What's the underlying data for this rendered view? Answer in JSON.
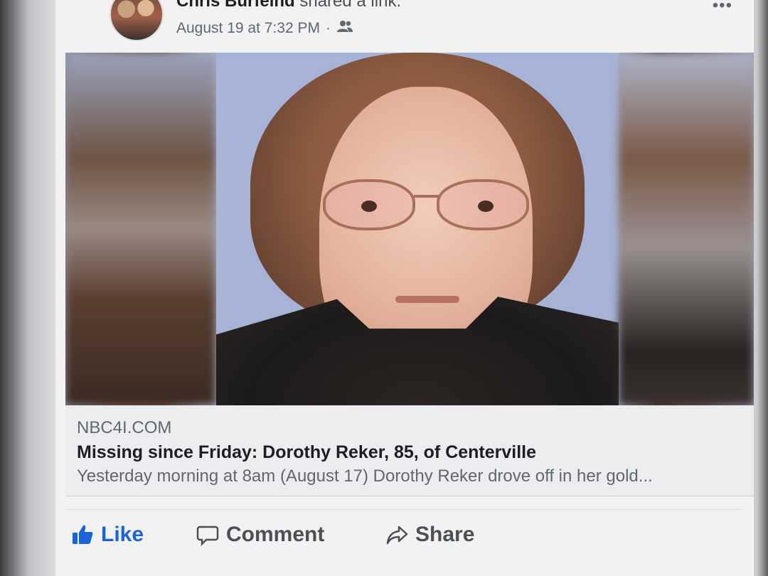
{
  "post": {
    "author": "Chris Burfeind",
    "action": "shared a link.",
    "timestamp": "August 19 at 7:32 PM",
    "separator": "·",
    "audience_icon": "friends-icon",
    "more_label": "•••"
  },
  "link": {
    "domain": "NBC4I.COM",
    "title": "Missing since Friday: Dorothy Reker, 85, of Centerville",
    "description": "Yesterday morning at 8am (August 17) Dorothy Reker drove off in her gold..."
  },
  "actions": {
    "like": "Like",
    "comment": "Comment",
    "share": "Share"
  },
  "colors": {
    "like_blue": "#1a63d8",
    "text_dark": "#1c1e21",
    "text_muted": "#606770"
  }
}
